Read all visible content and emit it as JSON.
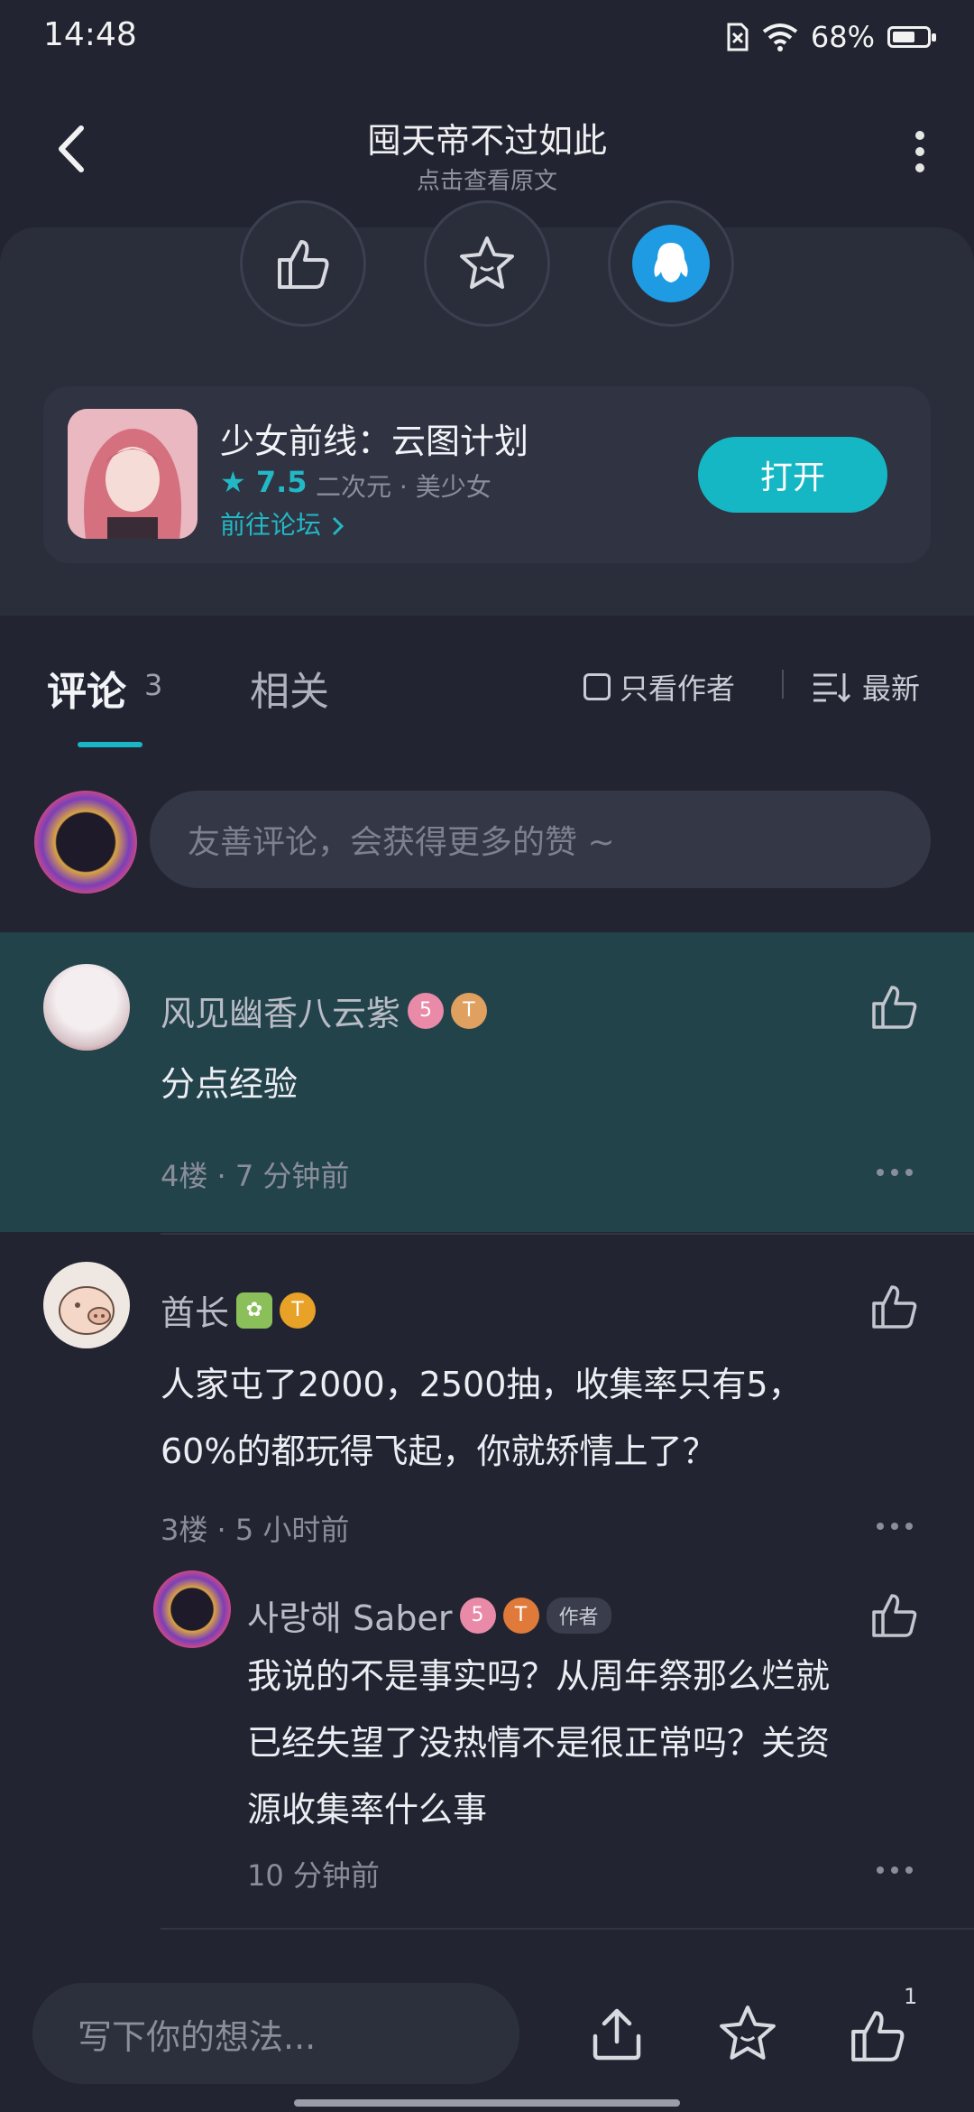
{
  "status": {
    "time": "14:48",
    "battery": "68%",
    "battery_level": 0.68
  },
  "header": {
    "title": "囤天帝不过如此",
    "subtitle": "点击查看原文"
  },
  "app": {
    "name": "少女前线：云图计划",
    "rating": "7.5",
    "tags": "二次元 · 美少女",
    "forum_link": "前往论坛",
    "open_label": "打开"
  },
  "tabs": {
    "comments_label": "评论",
    "comments_count": "3",
    "related_label": "相关"
  },
  "filters": {
    "author_only": "只看作者",
    "sort_label": "最新"
  },
  "comment_input": {
    "placeholder": "友善评论，会获得更多的赞 ~"
  },
  "comments": [
    {
      "name": "风见幽香八云紫",
      "text": "分点经验",
      "meta": "4楼 · 7 分钟前"
    },
    {
      "name": "酋长",
      "text_line1": "人家屯了2000，2500抽，收集率只有5，",
      "text_line2": "60%的都玩得飞起，你就矫情上了？",
      "meta": "3楼 · 5 小时前"
    }
  ],
  "reply": {
    "name": "사랑해 Saber",
    "author_tag": "作者",
    "line1": "我说的不是事实吗？从周年祭那么烂就",
    "line2": "已经失望了没热情不是很正常吗？关资",
    "line3": "源收集率什么事",
    "meta": "10 分钟前"
  },
  "bottom": {
    "placeholder": "写下你的想法...",
    "like_count": "1"
  },
  "colors": {
    "accent": "#16b7c4",
    "background": "#222531",
    "highlight": "#23434b"
  }
}
